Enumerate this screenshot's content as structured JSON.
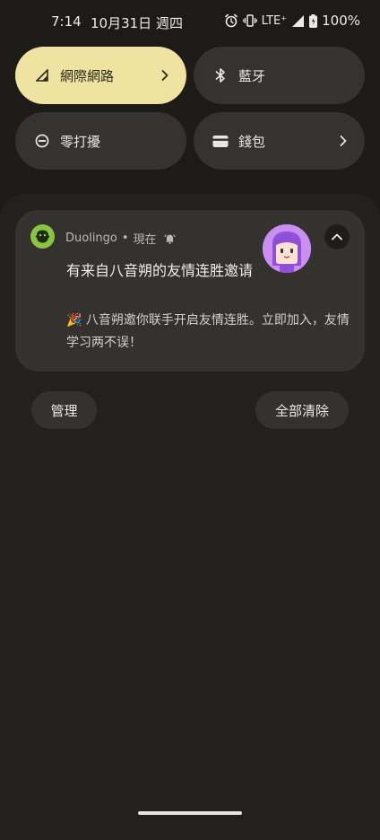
{
  "status_bar": {
    "time": "7:14",
    "date": "10月31日 週四",
    "network": "LTE⁺",
    "battery": "100%",
    "icons": [
      "alarm-icon",
      "vibrate-icon",
      "signal-icon",
      "battery-icon"
    ]
  },
  "quick_tiles": [
    {
      "label": "網際網路",
      "icon": "signal-icon",
      "active": true,
      "has_chevron": true
    },
    {
      "label": "藍牙",
      "icon": "bluetooth-icon",
      "active": false,
      "has_chevron": false
    },
    {
      "label": "零打擾",
      "icon": "do-not-disturb-icon",
      "active": false,
      "has_chevron": false
    },
    {
      "label": "錢包",
      "icon": "wallet-icon",
      "active": false,
      "has_chevron": true
    }
  ],
  "notification": {
    "app_name": "Duolingo",
    "separator": "•",
    "time": "現在",
    "title": "有来自八音朔的友情连胜邀请",
    "body": "🎉 八音朔邀你联手开启友情连胜。立即加入，友情学习两不误！",
    "icon": "duolingo-owl-icon"
  },
  "actions": {
    "manage_label": "管理",
    "clear_all_label": "全部清除"
  },
  "colors": {
    "active_tile": "#eee3a1",
    "tile": "#34332f",
    "background": "#1c1b18",
    "card": "#33322e",
    "duolingo_green": "#89c540",
    "avatar_purple": "#ca8ef3"
  }
}
